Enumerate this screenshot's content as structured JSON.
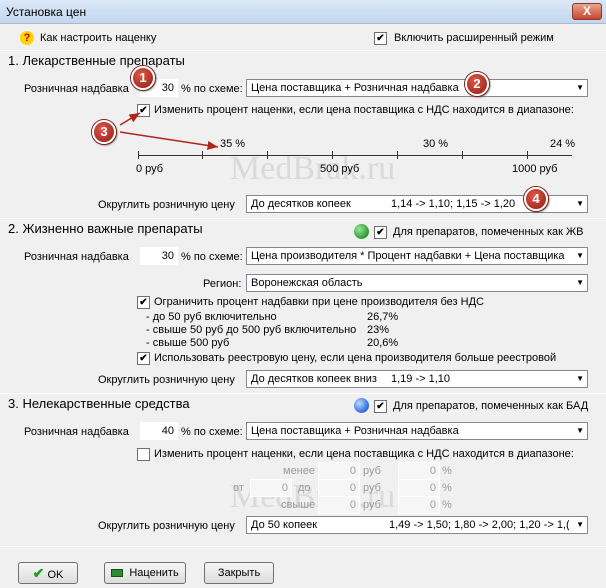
{
  "window": {
    "title": "Установка цен",
    "close": "X"
  },
  "top": {
    "help_label": "Как настроить наценку",
    "extended_mode_label": "Включить расширенный режим",
    "extended_mode_checked": true
  },
  "s1": {
    "title": "1. Лекарственные препараты",
    "markup_label": "Розничная надбавка",
    "markup_value": "30",
    "scheme_label": "% по схеме:",
    "scheme_value": "Цена поставщика + Розничная надбавка",
    "range_check_label": "Изменить процент наценки, если цена поставщика с НДС находится в диапазоне:",
    "range_checked": true,
    "scale_labels": [
      "0 руб",
      "500 руб",
      "1000 руб"
    ],
    "scale_percents": [
      "35 %",
      "30 %",
      "24 %"
    ],
    "round_label": "Округлить розничную цену",
    "round_value": "До десятков копеек",
    "round_example": "1,14 -> 1,10;  1,15 -> 1,20"
  },
  "s2": {
    "title": "2. Жизненно важные препараты",
    "marked_label": "Для препаратов, помеченных как ЖВ",
    "marked_checked": true,
    "markup_label": "Розничная надбавка",
    "markup_value": "30",
    "scheme_label": "% по схеме:",
    "scheme_value": "Цена производителя * Процент надбавки + Цена поставщика",
    "region_label": "Регион:",
    "region_value": "Воронежская область",
    "limit_label": "Ограничить процент надбавки при цене производителя без НДС",
    "limit_checked": true,
    "limits": [
      {
        "label": "- до 50 руб  включительно",
        "value": "26,7%"
      },
      {
        "label": "- свыше 50 руб до 500 руб включительно",
        "value": "23%"
      },
      {
        "label": "- свыше 500 руб",
        "value": "20,6%"
      }
    ],
    "registry_label": "Использовать реестровую цену, если цена производителя больше реестровой",
    "registry_checked": true,
    "round_label": "Округлить розничную цену",
    "round_value": "До десятков копеек вниз",
    "round_example": "1,19 -> 1,10"
  },
  "s3": {
    "title": "3. Нелекарственные средства",
    "marked_label": "Для препаратов, помеченных как БАД",
    "marked_checked": true,
    "markup_label": "Розничная надбавка",
    "markup_value": "40",
    "scheme_label": "% по схеме:",
    "scheme_value": "Цена поставщика + Розничная надбавка",
    "range_check_label": "Изменить процент наценки, если цена поставщика с НДС находится в диапазоне:",
    "range_checked": false,
    "less_label": "менее",
    "from_label": "от",
    "to_label": "до",
    "more_label": "свыше",
    "rub": "руб",
    "pct": "%",
    "zero": "0",
    "round_label": "Округлить розничную цену",
    "round_value": "До 50 копеек",
    "round_example": "1,49 -> 1,50;  1,80 -> 2,00;  1,20 -> 1,("
  },
  "buttons": {
    "ok": "OK",
    "apply": "Наценить",
    "close": "Закрыть"
  },
  "badges": [
    "1",
    "2",
    "3",
    "4"
  ],
  "watermark": "MedBrak.ru",
  "colors": {
    "badge": "#b0241c",
    "green_ball": "#3aa63a",
    "blue_ball": "#3a7be0"
  }
}
